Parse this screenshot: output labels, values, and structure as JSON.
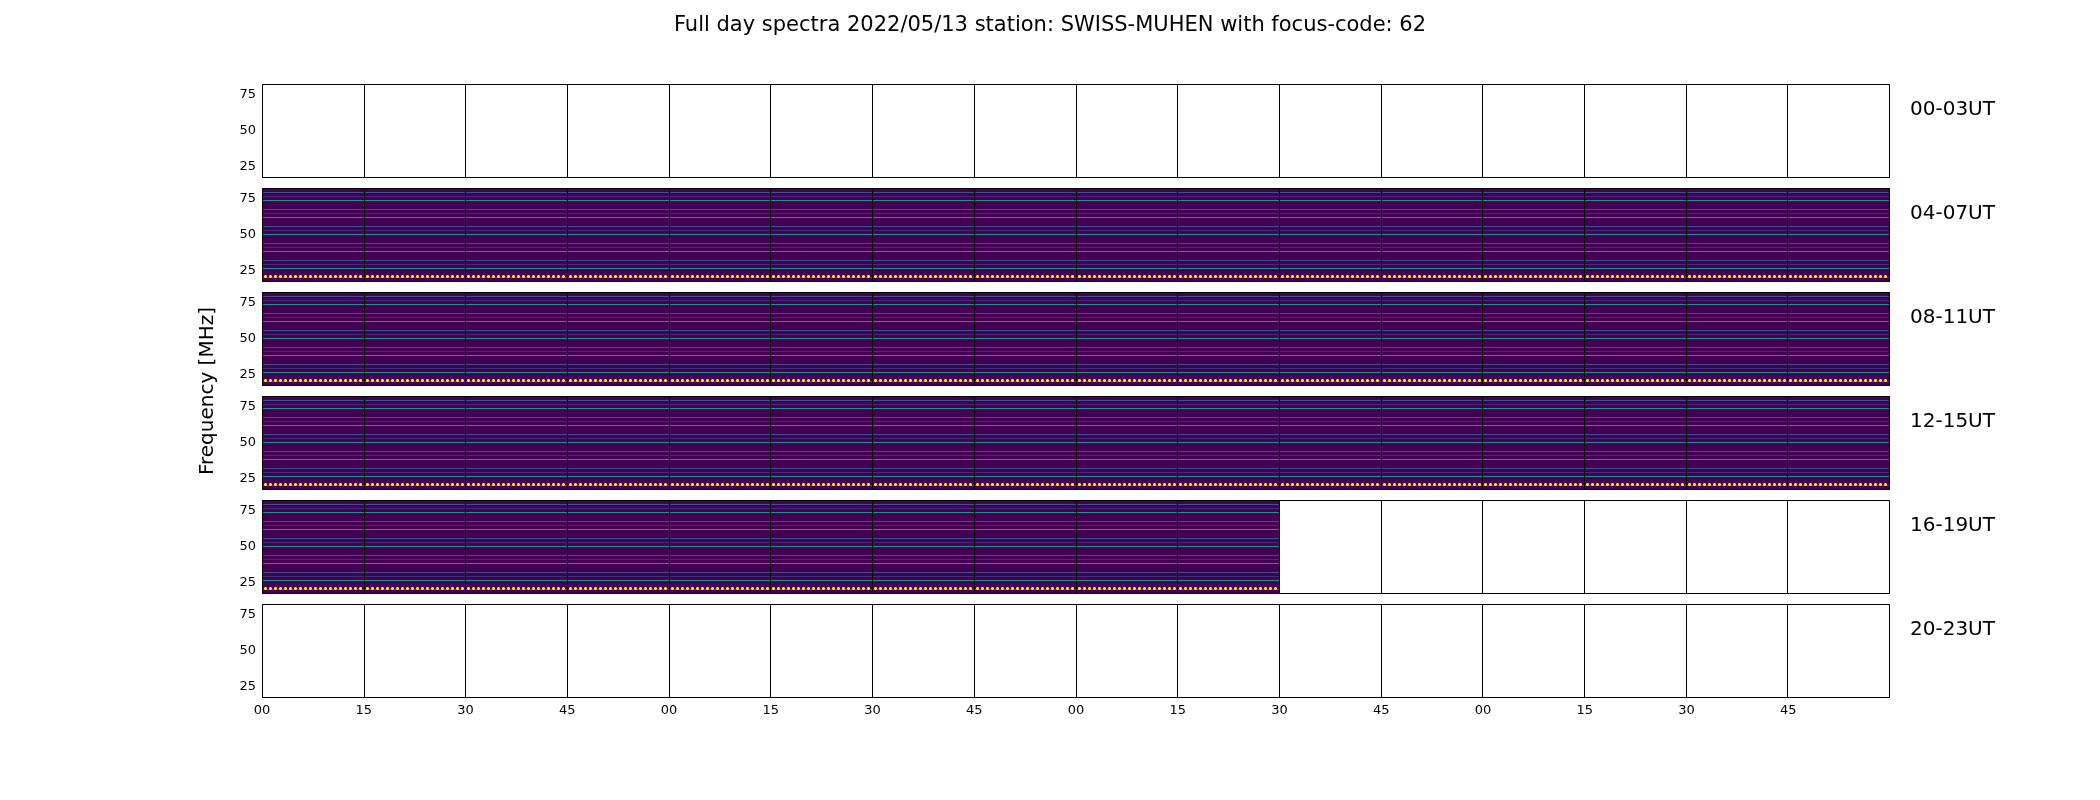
{
  "title": "Full day spectra 2022/05/13 station: SWISS-MUHEN with focus-code: 62",
  "ylabel": "Frequency [MHz]",
  "rows": [
    {
      "label": "00-03UT",
      "yticks": [
        "75",
        "50",
        "25"
      ],
      "panels": [
        {
          "has_data": false
        },
        {
          "has_data": false
        },
        {
          "has_data": false
        },
        {
          "has_data": false
        },
        {
          "has_data": false
        },
        {
          "has_data": false
        },
        {
          "has_data": false
        },
        {
          "has_data": false
        },
        {
          "has_data": false
        },
        {
          "has_data": false
        },
        {
          "has_data": false
        },
        {
          "has_data": false
        },
        {
          "has_data": false
        },
        {
          "has_data": false
        },
        {
          "has_data": false
        },
        {
          "has_data": false
        }
      ]
    },
    {
      "label": "04-07UT",
      "yticks": [
        "75",
        "50",
        "25"
      ],
      "panels": [
        {
          "has_data": true
        },
        {
          "has_data": true
        },
        {
          "has_data": true
        },
        {
          "has_data": true
        },
        {
          "has_data": true
        },
        {
          "has_data": true
        },
        {
          "has_data": true
        },
        {
          "has_data": true
        },
        {
          "has_data": true
        },
        {
          "has_data": true
        },
        {
          "has_data": true
        },
        {
          "has_data": true
        },
        {
          "has_data": true
        },
        {
          "has_data": true
        },
        {
          "has_data": true
        },
        {
          "has_data": true
        }
      ]
    },
    {
      "label": "08-11UT",
      "yticks": [
        "75",
        "50",
        "25"
      ],
      "panels": [
        {
          "has_data": true
        },
        {
          "has_data": true
        },
        {
          "has_data": true
        },
        {
          "has_data": true
        },
        {
          "has_data": true
        },
        {
          "has_data": true
        },
        {
          "has_data": true
        },
        {
          "has_data": true
        },
        {
          "has_data": true
        },
        {
          "has_data": true
        },
        {
          "has_data": true
        },
        {
          "has_data": true
        },
        {
          "has_data": true
        },
        {
          "has_data": true
        },
        {
          "has_data": true
        },
        {
          "has_data": true
        }
      ]
    },
    {
      "label": "12-15UT",
      "yticks": [
        "75",
        "50",
        "25"
      ],
      "panels": [
        {
          "has_data": true
        },
        {
          "has_data": true
        },
        {
          "has_data": true
        },
        {
          "has_data": true
        },
        {
          "has_data": true
        },
        {
          "has_data": true
        },
        {
          "has_data": true
        },
        {
          "has_data": true
        },
        {
          "has_data": true
        },
        {
          "has_data": true
        },
        {
          "has_data": true
        },
        {
          "has_data": true
        },
        {
          "has_data": true
        },
        {
          "has_data": true
        },
        {
          "has_data": true
        },
        {
          "has_data": true
        }
      ]
    },
    {
      "label": "16-19UT",
      "yticks": [
        "75",
        "50",
        "25"
      ],
      "panels": [
        {
          "has_data": true
        },
        {
          "has_data": true
        },
        {
          "has_data": true
        },
        {
          "has_data": true
        },
        {
          "has_data": true
        },
        {
          "has_data": true
        },
        {
          "has_data": true
        },
        {
          "has_data": true
        },
        {
          "has_data": true
        },
        {
          "has_data": true
        },
        {
          "has_data": false
        },
        {
          "has_data": false
        },
        {
          "has_data": false
        },
        {
          "has_data": false
        },
        {
          "has_data": false
        },
        {
          "has_data": false
        }
      ]
    },
    {
      "label": "20-23UT",
      "yticks": [
        "75",
        "50",
        "25"
      ],
      "panels": [
        {
          "has_data": false
        },
        {
          "has_data": false
        },
        {
          "has_data": false
        },
        {
          "has_data": false
        },
        {
          "has_data": false
        },
        {
          "has_data": false
        },
        {
          "has_data": false
        },
        {
          "has_data": false
        },
        {
          "has_data": false
        },
        {
          "has_data": false
        },
        {
          "has_data": false
        },
        {
          "has_data": false
        },
        {
          "has_data": false
        },
        {
          "has_data": false
        },
        {
          "has_data": false
        },
        {
          "has_data": false
        }
      ]
    }
  ],
  "xticks": [
    "00",
    "15",
    "30",
    "45",
    "00",
    "15",
    "30",
    "45",
    "00",
    "15",
    "30",
    "45",
    "00",
    "15",
    "30",
    "45"
  ]
}
